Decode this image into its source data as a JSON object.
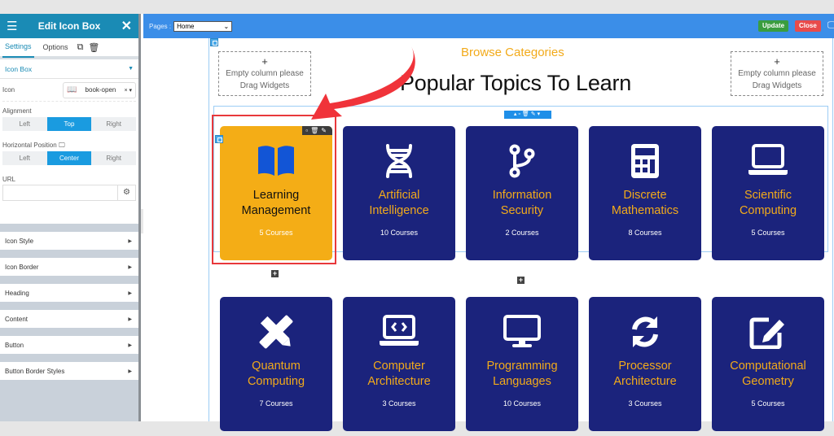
{
  "sidebar": {
    "title": "Edit Icon Box",
    "tabs": [
      {
        "label": "Settings",
        "active": true
      },
      {
        "label": "Options",
        "active": false
      }
    ],
    "section_title": "Icon Box",
    "icon_field": {
      "label": "Icon",
      "value": "book-open"
    },
    "alignment": {
      "label": "Alignment",
      "options": [
        "Left",
        "Top",
        "Right"
      ],
      "selected": "Top"
    },
    "horizontal_position": {
      "label": "Horizontal Position",
      "options": [
        "Left",
        "Center",
        "Right"
      ],
      "selected": "Center"
    },
    "url": {
      "label": "URL",
      "value": ""
    },
    "accordions": [
      "Icon Style",
      "Icon Border",
      "Heading",
      "Content",
      "Button",
      "Button Border Styles"
    ]
  },
  "topbar": {
    "pages_label": "Pages :",
    "page_selected": "Home",
    "update_label": "Update",
    "close_label": "Close"
  },
  "canvas": {
    "empty_column_plus": "+",
    "empty_column_line1": "Empty column please",
    "empty_column_line2": "Drag Widgets",
    "subtitle": "Browse Categories",
    "title": "Popular Topics To Learn",
    "colors": {
      "card_bg": "#1b237c",
      "active_card_bg": "#f4ad16",
      "accent": "#f2aa1a",
      "selection": "#e8383b"
    },
    "cards": [
      {
        "title_1": "Learning",
        "title_2": "Management",
        "count": "5 Courses",
        "icon": "book-open-icon",
        "active": true
      },
      {
        "title_1": "Artificial",
        "title_2": "Intelligence",
        "count": "10 Courses",
        "icon": "dna-icon"
      },
      {
        "title_1": "Information",
        "title_2": "Security",
        "count": "2 Courses",
        "icon": "code-branch-icon"
      },
      {
        "title_1": "Discrete",
        "title_2": "Mathematics",
        "count": "8 Courses",
        "icon": "calculator-icon"
      },
      {
        "title_1": "Scientific",
        "title_2": "Computing",
        "count": "5 Courses",
        "icon": "laptop-icon"
      },
      {
        "title_1": "Quantum",
        "title_2": "Computing",
        "count": "7 Courses",
        "icon": "pencil-ruler-icon"
      },
      {
        "title_1": "Computer",
        "title_2": "Architecture",
        "count": "3 Courses",
        "icon": "laptop-code-icon"
      },
      {
        "title_1": "Programming",
        "title_2": "Languages",
        "count": "10 Courses",
        "icon": "desktop-icon"
      },
      {
        "title_1": "Processor",
        "title_2": "Architecture",
        "count": "3 Courses",
        "icon": "sync-icon"
      },
      {
        "title_1": "Computational",
        "title_2": "Geometry",
        "count": "5 Courses",
        "icon": "edit-icon"
      }
    ]
  }
}
